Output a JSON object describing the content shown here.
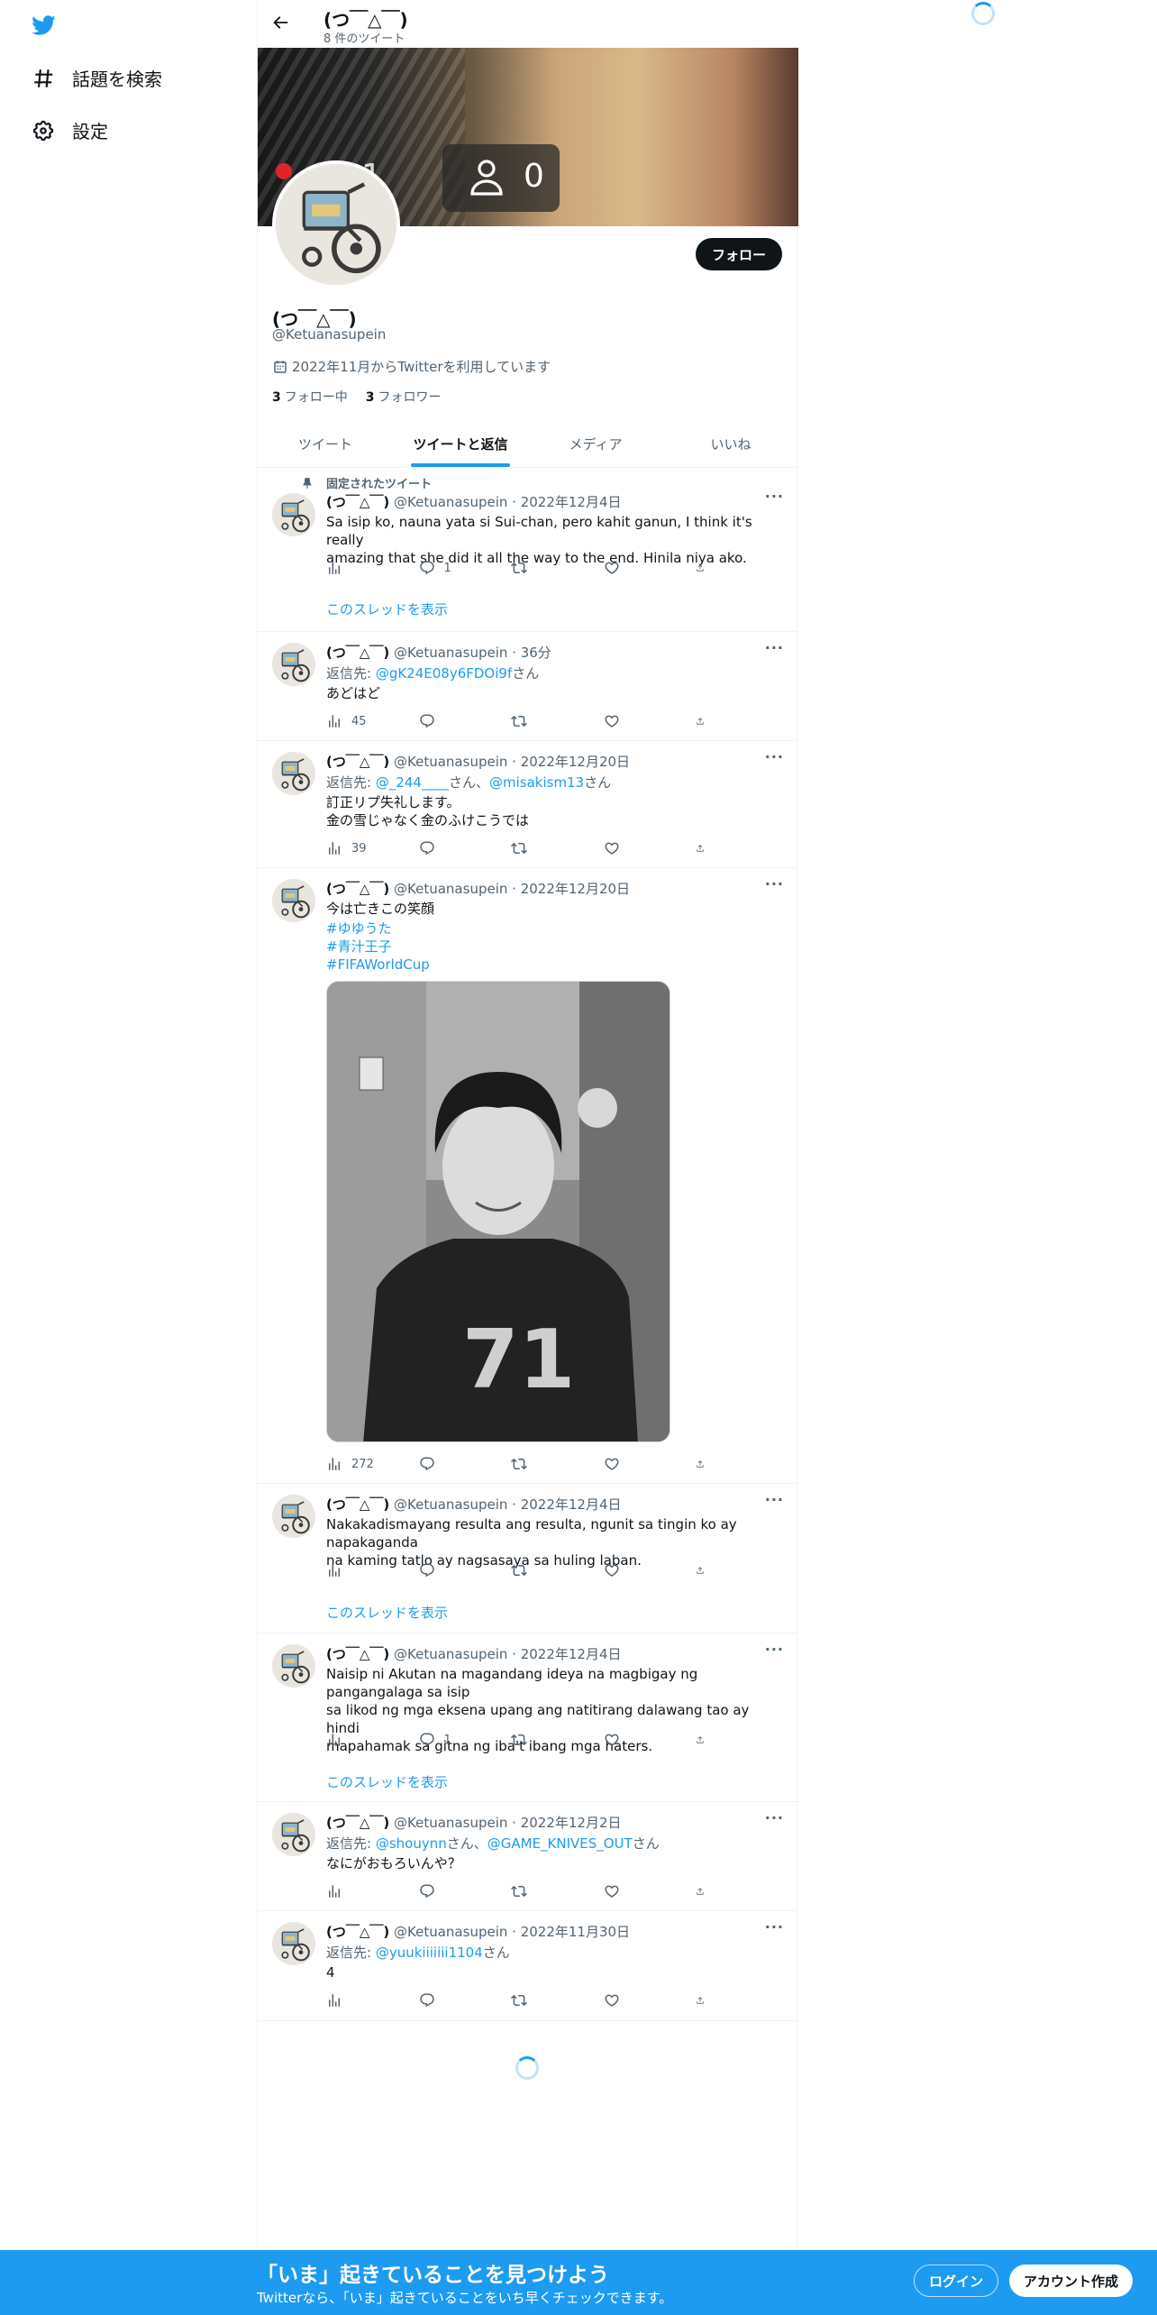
{
  "sidebar": {
    "items": [
      {
        "label": "話題を検索",
        "icon": "hashtag-icon"
      },
      {
        "label": "設定",
        "icon": "gear-icon"
      }
    ]
  },
  "topbar": {
    "name": "(つ￣△￣)",
    "tweet_count": "8 件のツイート"
  },
  "banner": {
    "overlay_left_number": "1",
    "overlay_number": "0"
  },
  "profile": {
    "follow_label": "フォロー",
    "name": "(つ￣△￣)",
    "handle": "@Ketuanasupein",
    "joined": "2022年11月からTwitterを利用しています",
    "following_count": "3",
    "following_label": "フォロー中",
    "followers_count": "3",
    "followers_label": "フォロワー"
  },
  "tabs": [
    {
      "label": "ツイート",
      "active": false
    },
    {
      "label": "ツイートと返信",
      "active": true
    },
    {
      "label": "メディア",
      "active": false
    },
    {
      "label": "いいね",
      "active": false
    }
  ],
  "show_thread_label": "このスレッドを表示",
  "tweets": [
    {
      "pinned_label": "固定されたツイート",
      "name": "(つ￣△￣)",
      "handle": "@Ketuanasupein",
      "time": "2022年12月4日",
      "text": "Sa isip ko, nauna yata si Sui-chan, pero kahit ganun, I think it's really\namazing that she did it all the way to the end. Hinila niya ako.",
      "views": "",
      "replies": "1"
    },
    {
      "name": "(つ￣△￣)",
      "handle": "@Ketuanasupein",
      "time": "36分",
      "reply_prefix": "返信先: ",
      "reply_to": "@gK24E08y6FDOi9f",
      "reply_suffix": "さん",
      "text": "あどはど",
      "views": "45",
      "replies": ""
    },
    {
      "name": "(つ￣△￣)",
      "handle": "@Ketuanasupein",
      "time": "2022年12月20日",
      "reply_prefix": "返信先: ",
      "reply_to": "@_244____",
      "reply_mid": "さん、",
      "reply_to2": "@misakism13",
      "reply_suffix": "さん",
      "text": "訂正リプ失礼します。\n金の雪じゃなく金のふけこうでは",
      "views": "39",
      "replies": ""
    },
    {
      "name": "(つ￣△￣)",
      "handle": "@Ketuanasupein",
      "time": "2022年12月20日",
      "text": "今は亡きこの笑顔",
      "hashtags": [
        "#ゆゆうた",
        "#青汁王子",
        "#FIFAWorldCup"
      ],
      "views": "272",
      "replies": ""
    },
    {
      "name": "(つ￣△￣)",
      "handle": "@Ketuanasupein",
      "time": "2022年12月4日",
      "text": "Nakakadismayang resulta ang resulta, ngunit sa tingin ko ay napakaganda\nna kaming tatlo ay nagsasaya sa huling laban.",
      "views": "",
      "replies": ""
    },
    {
      "name": "(つ￣△￣)",
      "handle": "@Ketuanasupein",
      "time": "2022年12月4日",
      "text": "Naisip ni Akutan na magandang ideya na magbigay ng pangangalaga sa isip\nsa likod ng mga eksena upang ang natitirang dalawang tao ay hindi\nmapahamak sa gitna ng iba't ibang mga haters.",
      "views": "",
      "replies": "1"
    },
    {
      "name": "(つ￣△￣)",
      "handle": "@Ketuanasupein",
      "time": "2022年12月2日",
      "reply_prefix": "返信先: ",
      "reply_to": "@shouynn",
      "reply_mid": "さん、",
      "reply_to2": "@GAME_KNIVES_OUT",
      "reply_suffix": "さん",
      "text": "なにがおもろいんや？",
      "views": "",
      "replies": ""
    },
    {
      "name": "(つ￣△￣)",
      "handle": "@Ketuanasupein",
      "time": "2022年11月30日",
      "reply_prefix": "返信先: ",
      "reply_to": "@yuukiiiiiii1104",
      "reply_suffix": "さん",
      "text": "4",
      "views": "",
      "replies": ""
    }
  ],
  "bottom": {
    "title": "「いま」起きていることを見つけよう",
    "subtitle": "Twitterなら、「いま」起きていることをいち早くチェックできます。",
    "login": "ログイン",
    "signup": "アカウント作成"
  },
  "colors": {
    "accent": "#1d9bf0",
    "text": "#0f1419",
    "muted": "#536471"
  }
}
